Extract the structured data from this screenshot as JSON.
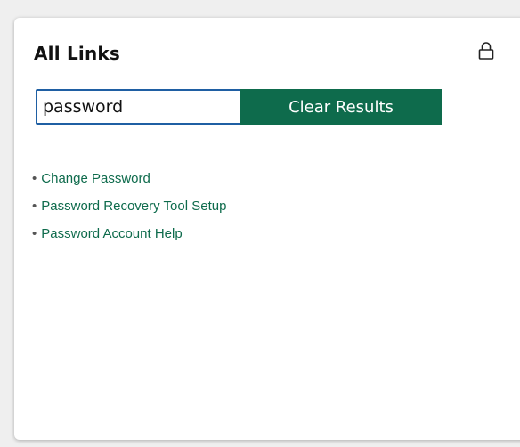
{
  "widget": {
    "title": "All Links",
    "lock_icon": "lock-icon"
  },
  "search": {
    "value": "password",
    "clear_label": "Clear Results"
  },
  "results": [
    {
      "bullet": "•",
      "label": "Change Password"
    },
    {
      "bullet": "•",
      "label": "Password Recovery Tool Setup"
    },
    {
      "bullet": "•",
      "label": "Password Account Help"
    }
  ],
  "colors": {
    "accent": "#0e6b4c",
    "input_border": "#1f5fa3",
    "background": "#efefef",
    "card": "#ffffff"
  }
}
